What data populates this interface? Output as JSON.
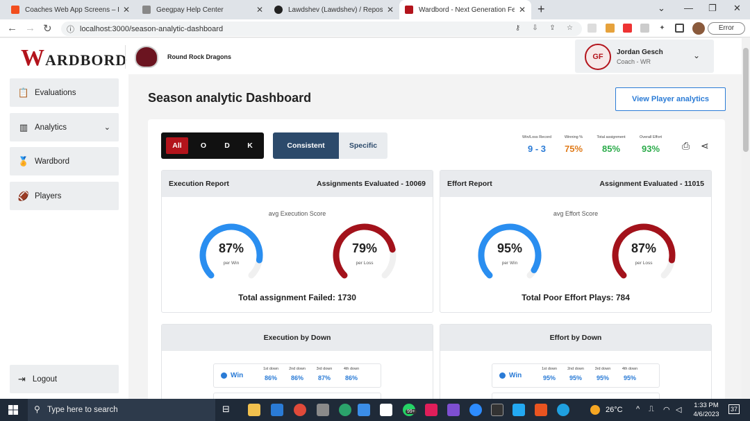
{
  "browser": {
    "tabs": [
      {
        "title": "Coaches Web App Screens – Figma",
        "color": "#f24e1e"
      },
      {
        "title": "Geegpay Help Center",
        "color": "#888888"
      },
      {
        "title": "Lawdshev (Lawdshev) / Repositor",
        "color": "#222222"
      },
      {
        "title": "Wardbord - Next Generation Fee",
        "color": "#b3141c"
      }
    ],
    "new_tab": "+",
    "url": "localhost:3000/season-analytic-dashboard",
    "error_label": "Error"
  },
  "header": {
    "logo_w": "W",
    "logo_rest": "ARDBORD",
    "team_name": "Round Rock Dragons",
    "user": {
      "name": "Jordan Gesch",
      "role": "Coach - WR",
      "initials": "GF"
    }
  },
  "sidebar": {
    "items": [
      {
        "label": "Evaluations",
        "icon": "clipboard-icon"
      },
      {
        "label": "Analytics",
        "icon": "bar-chart-icon"
      },
      {
        "label": "Wardbord",
        "icon": "medal-icon"
      },
      {
        "label": "Players",
        "icon": "football-icon"
      }
    ],
    "logout": "Logout"
  },
  "main": {
    "title": "Season analytic Dashboard",
    "view_player_btn": "View Player analytics",
    "filters": [
      "All",
      "O",
      "D",
      "K"
    ],
    "modes": [
      "Consistent",
      "Specific"
    ],
    "stats": [
      {
        "label": "Win/Loss Record",
        "value": "9 - 3",
        "color": "#2a7bd6"
      },
      {
        "label": "Winning %",
        "value": "75%",
        "color": "#e07b1a"
      },
      {
        "label": "Total assignment",
        "value": "85%",
        "color": "#2bab4a"
      },
      {
        "label": "Overall Effort",
        "value": "93%",
        "color": "#2bab4a"
      }
    ],
    "execution": {
      "title": "Execution Report",
      "evaluated": "Assignments Evaluated - 10069",
      "avg_label": "avg Execution Score",
      "win": {
        "value": "87%",
        "sub": "per Win",
        "level": 87,
        "color": "#2a8ef0"
      },
      "loss": {
        "value": "79%",
        "sub": "per Loss",
        "level": 79,
        "color": "#a3121b"
      },
      "footer": "Total assignment Failed: 1730"
    },
    "effort": {
      "title": "Effort Report",
      "evaluated": "Assignment Evaluated - 11015",
      "avg_label": "avg Effort Score",
      "win": {
        "value": "95%",
        "sub": "per Win",
        "level": 95,
        "color": "#2a8ef0"
      },
      "loss": {
        "value": "87%",
        "sub": "per Loss",
        "level": 87,
        "color": "#a3121b"
      },
      "footer": "Total Poor Effort Plays: 784"
    },
    "exec_by_down": {
      "title": "Execution by Down",
      "win_label": "Win",
      "downs": [
        "1st down",
        "2nd down",
        "3rd down",
        "4th down"
      ],
      "values": [
        "86%",
        "86%",
        "87%",
        "86%"
      ]
    },
    "effort_by_down": {
      "title": "Effort by Down",
      "win_label": "Win",
      "downs": [
        "1st down",
        "2nd down",
        "3rd down",
        "4th down"
      ],
      "values": [
        "95%",
        "95%",
        "95%",
        "95%"
      ]
    }
  },
  "taskbar": {
    "search": "Type here to search",
    "weather": "26°C",
    "time": "1:33 PM",
    "date": "4/6/2023",
    "badge": "99+",
    "notif": "37"
  }
}
